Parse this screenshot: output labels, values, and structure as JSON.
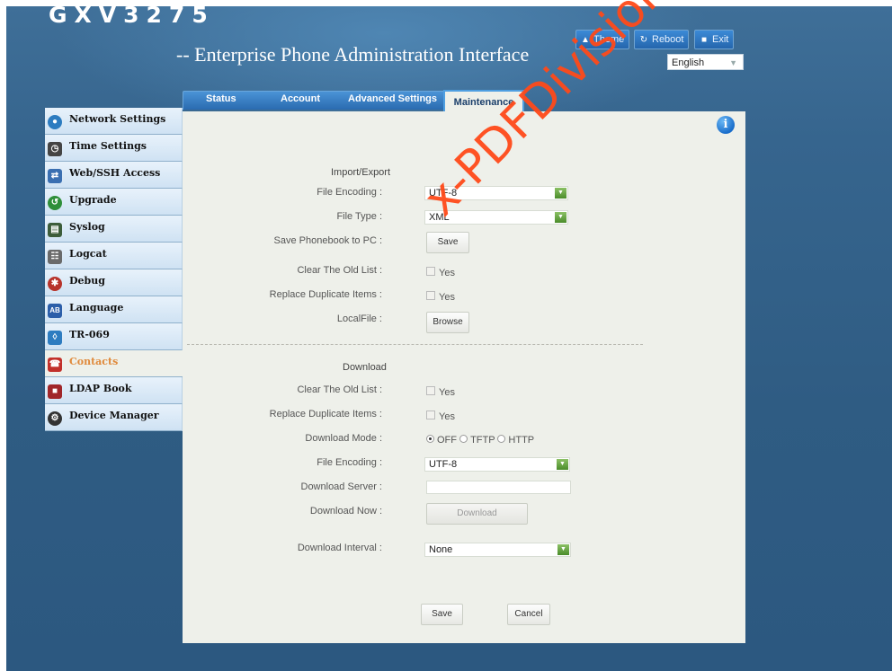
{
  "header": {
    "brand": "GXV3275",
    "subtitle": "-- Enterprise Phone Administration Interface",
    "buttons": [
      {
        "label": "Theme",
        "icon": "shirt-icon"
      },
      {
        "label": "Reboot",
        "icon": "reboot-icon"
      },
      {
        "label": "Exit",
        "icon": "exit-icon"
      }
    ],
    "language": "English"
  },
  "tabs": [
    {
      "label": "Status"
    },
    {
      "label": "Account"
    },
    {
      "label": "Advanced Settings"
    },
    {
      "label": "Maintenance",
      "active": true
    }
  ],
  "sidebar": {
    "items": [
      {
        "label": "Network Settings",
        "icon": "network-icon",
        "color": "#2d7cc0"
      },
      {
        "label": "Time Settings",
        "icon": "clock-icon",
        "color": "#444444"
      },
      {
        "label": "Web/SSH Access",
        "icon": "web-ssh-icon",
        "color": "#3a6fb1"
      },
      {
        "label": "Upgrade",
        "icon": "upgrade-icon",
        "color": "#2f8f3a"
      },
      {
        "label": "Syslog",
        "icon": "syslog-icon",
        "color": "#3d5d3a"
      },
      {
        "label": "Logcat",
        "icon": "logcat-icon",
        "color": "#6a6a6a"
      },
      {
        "label": "Debug",
        "icon": "debug-icon",
        "color": "#b7332b"
      },
      {
        "label": "Language",
        "icon": "language-icon",
        "color": "#2b5ea9"
      },
      {
        "label": "TR-069",
        "icon": "tr069-icon",
        "color": "#2d7cc0"
      },
      {
        "label": "Contacts",
        "icon": "contacts-icon",
        "color": "#c2302a",
        "active": true
      },
      {
        "label": "LDAP Book",
        "icon": "ldap-book-icon",
        "color": "#a0262a"
      },
      {
        "label": "Device Manager",
        "icon": "device-manager-icon",
        "color": "#333333"
      }
    ]
  },
  "import_export": {
    "title": "Import/Export",
    "file_encoding": {
      "label": "File Encoding :",
      "value": "UTF-8"
    },
    "file_type": {
      "label": "File Type :",
      "value": "XML"
    },
    "save_phonebook": {
      "label": "Save Phonebook to PC :",
      "button": "Save"
    },
    "clear_old_list": {
      "label": "Clear The Old List :",
      "option": "Yes"
    },
    "replace_duplicate": {
      "label": "Replace Duplicate Items :",
      "option": "Yes"
    },
    "local_file": {
      "label": "LocalFile :",
      "button": "Browse"
    }
  },
  "download": {
    "title": "Download",
    "clear_old_list": {
      "label": "Clear The Old List :",
      "option": "Yes"
    },
    "replace_duplicate": {
      "label": "Replace Duplicate Items :",
      "option": "Yes"
    },
    "mode": {
      "label": "Download Mode :",
      "options": [
        "OFF",
        "TFTP",
        "HTTP"
      ],
      "selected": "OFF"
    },
    "file_encoding": {
      "label": "File Encoding :",
      "value": "UTF-8"
    },
    "server": {
      "label": "Download Server :",
      "value": ""
    },
    "download_now": {
      "label": "Download Now :",
      "button": "Download"
    },
    "interval": {
      "label": "Download Interval :",
      "value": "None"
    }
  },
  "actions": {
    "save": "Save",
    "cancel": "Cancel"
  },
  "watermark": "x-PDFDivision"
}
